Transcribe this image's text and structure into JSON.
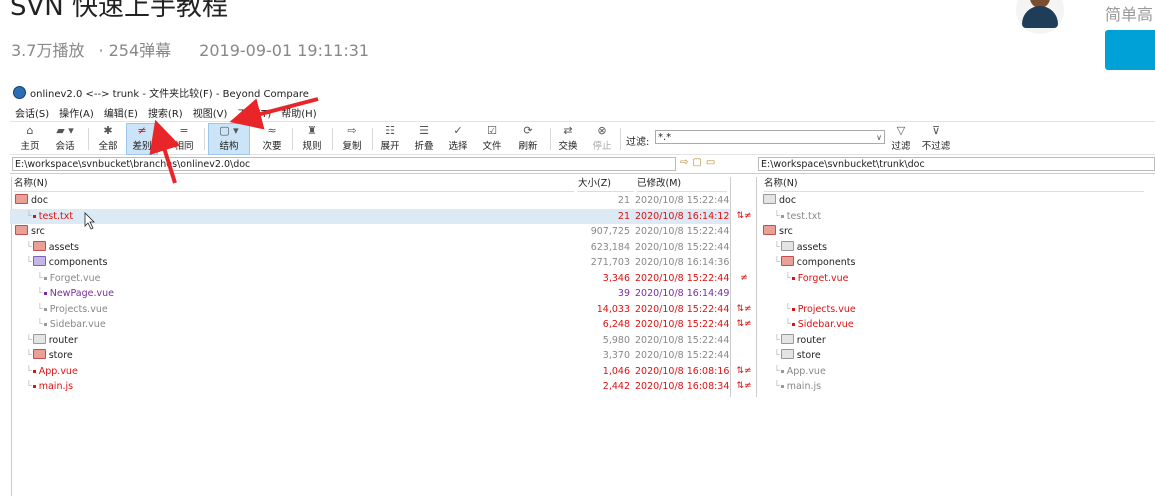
{
  "video": {
    "title": "SVN 快速上手教程",
    "plays": "3.7万播放",
    "danmaku": "254弹幕",
    "datetime": "2019-09-01 19:11:31",
    "uploader_desc": "简单高"
  },
  "window": {
    "title": "onlinev2.0 <--> trunk - 文件夹比较(F) - Beyond Compare"
  },
  "menu": [
    "会话(S)",
    "操作(A)",
    "编辑(E)",
    "搜索(R)",
    "视图(V)",
    "工具(T)",
    "帮助(H)"
  ],
  "toolbar": {
    "home": "主页",
    "session": "会话",
    "all": "全部",
    "diff": "差别",
    "same": "相同",
    "structure": "结构",
    "minor": "次要",
    "rules": "规则",
    "copy": "复制",
    "expand": "展开",
    "collapse": "折叠",
    "select": "选择",
    "files": "文件",
    "refresh": "刷新",
    "swap": "交换",
    "stop": "停止",
    "filter_label": "过滤:",
    "filter_value": "*.*",
    "filter": "过滤",
    "no_filter": "不过滤"
  },
  "paths": {
    "left": "E:\\workspace\\svnbucket\\branches\\onlinev2.0\\doc",
    "right": "E:\\workspace\\svnbucket\\trunk\\doc"
  },
  "columns": {
    "name": "名称(N)",
    "size": "大小(Z)",
    "modified": "已修改(M)",
    "name_right": "名称(N)"
  },
  "left_rows": [
    {
      "name": "doc",
      "type": "folder-red",
      "size": "21",
      "modified": "2020/10/8 15:22:44",
      "cmp": ""
    },
    {
      "name": "test.txt",
      "type": "file-red",
      "size": "21",
      "modified": "2020/10/8 16:14:12",
      "cmp": "⇅≠"
    },
    {
      "name": "src",
      "type": "folder-red",
      "size": "907,725",
      "modified": "2020/10/8 15:22:44",
      "cmp": ""
    },
    {
      "name": "assets",
      "type": "folder-red",
      "size": "623,184",
      "modified": "2020/10/8 15:22:44",
      "cmp": ""
    },
    {
      "name": "components",
      "type": "folder-purple",
      "size": "271,703",
      "modified": "2020/10/8 16:14:36",
      "cmp": ""
    },
    {
      "name": "Forget.vue",
      "type": "file-gray",
      "size": "3,346",
      "modified": "2020/10/8 15:22:44",
      "cmp": "≠"
    },
    {
      "name": "NewPage.vue",
      "type": "file-purple",
      "size": "39",
      "modified": "2020/10/8 16:14:49",
      "cmp": ""
    },
    {
      "name": "Projects.vue",
      "type": "file-gray",
      "size": "14,033",
      "modified": "2020/10/8 15:22:44",
      "cmp": "⇅≠"
    },
    {
      "name": "Sidebar.vue",
      "type": "file-gray",
      "size": "6,248",
      "modified": "2020/10/8 15:22:44",
      "cmp": "⇅≠"
    },
    {
      "name": "router",
      "type": "folder-gray",
      "size": "5,980",
      "modified": "2020/10/8 15:22:44",
      "cmp": ""
    },
    {
      "name": "store",
      "type": "folder-red",
      "size": "3,370",
      "modified": "2020/10/8 15:22:44",
      "cmp": ""
    },
    {
      "name": "App.vue",
      "type": "file-red",
      "size": "1,046",
      "modified": "2020/10/8 16:08:16",
      "cmp": "⇅≠"
    },
    {
      "name": "main.js",
      "type": "file-red",
      "size": "2,442",
      "modified": "2020/10/8 16:08:34",
      "cmp": "⇅≠"
    }
  ],
  "right_rows": [
    {
      "name": "doc",
      "type": "folder-gray"
    },
    {
      "name": "test.txt",
      "type": "file-gray"
    },
    {
      "name": "src",
      "type": "folder-red"
    },
    {
      "name": "assets",
      "type": "folder-gray"
    },
    {
      "name": "components",
      "type": "folder-red"
    },
    {
      "name": "Forget.vue",
      "type": "file-red"
    },
    {
      "name": "",
      "type": "empty"
    },
    {
      "name": "Projects.vue",
      "type": "file-red"
    },
    {
      "name": "Sidebar.vue",
      "type": "file-red"
    },
    {
      "name": "router",
      "type": "folder-gray"
    },
    {
      "name": "store",
      "type": "folder-gray"
    },
    {
      "name": "App.vue",
      "type": "file-gray"
    },
    {
      "name": "main.js",
      "type": "file-gray"
    }
  ],
  "colors": {
    "diff_red": "#d11111",
    "orphan_purple": "#7a2da0",
    "accent": "#00a1d6",
    "annotation": "#e8262a"
  }
}
